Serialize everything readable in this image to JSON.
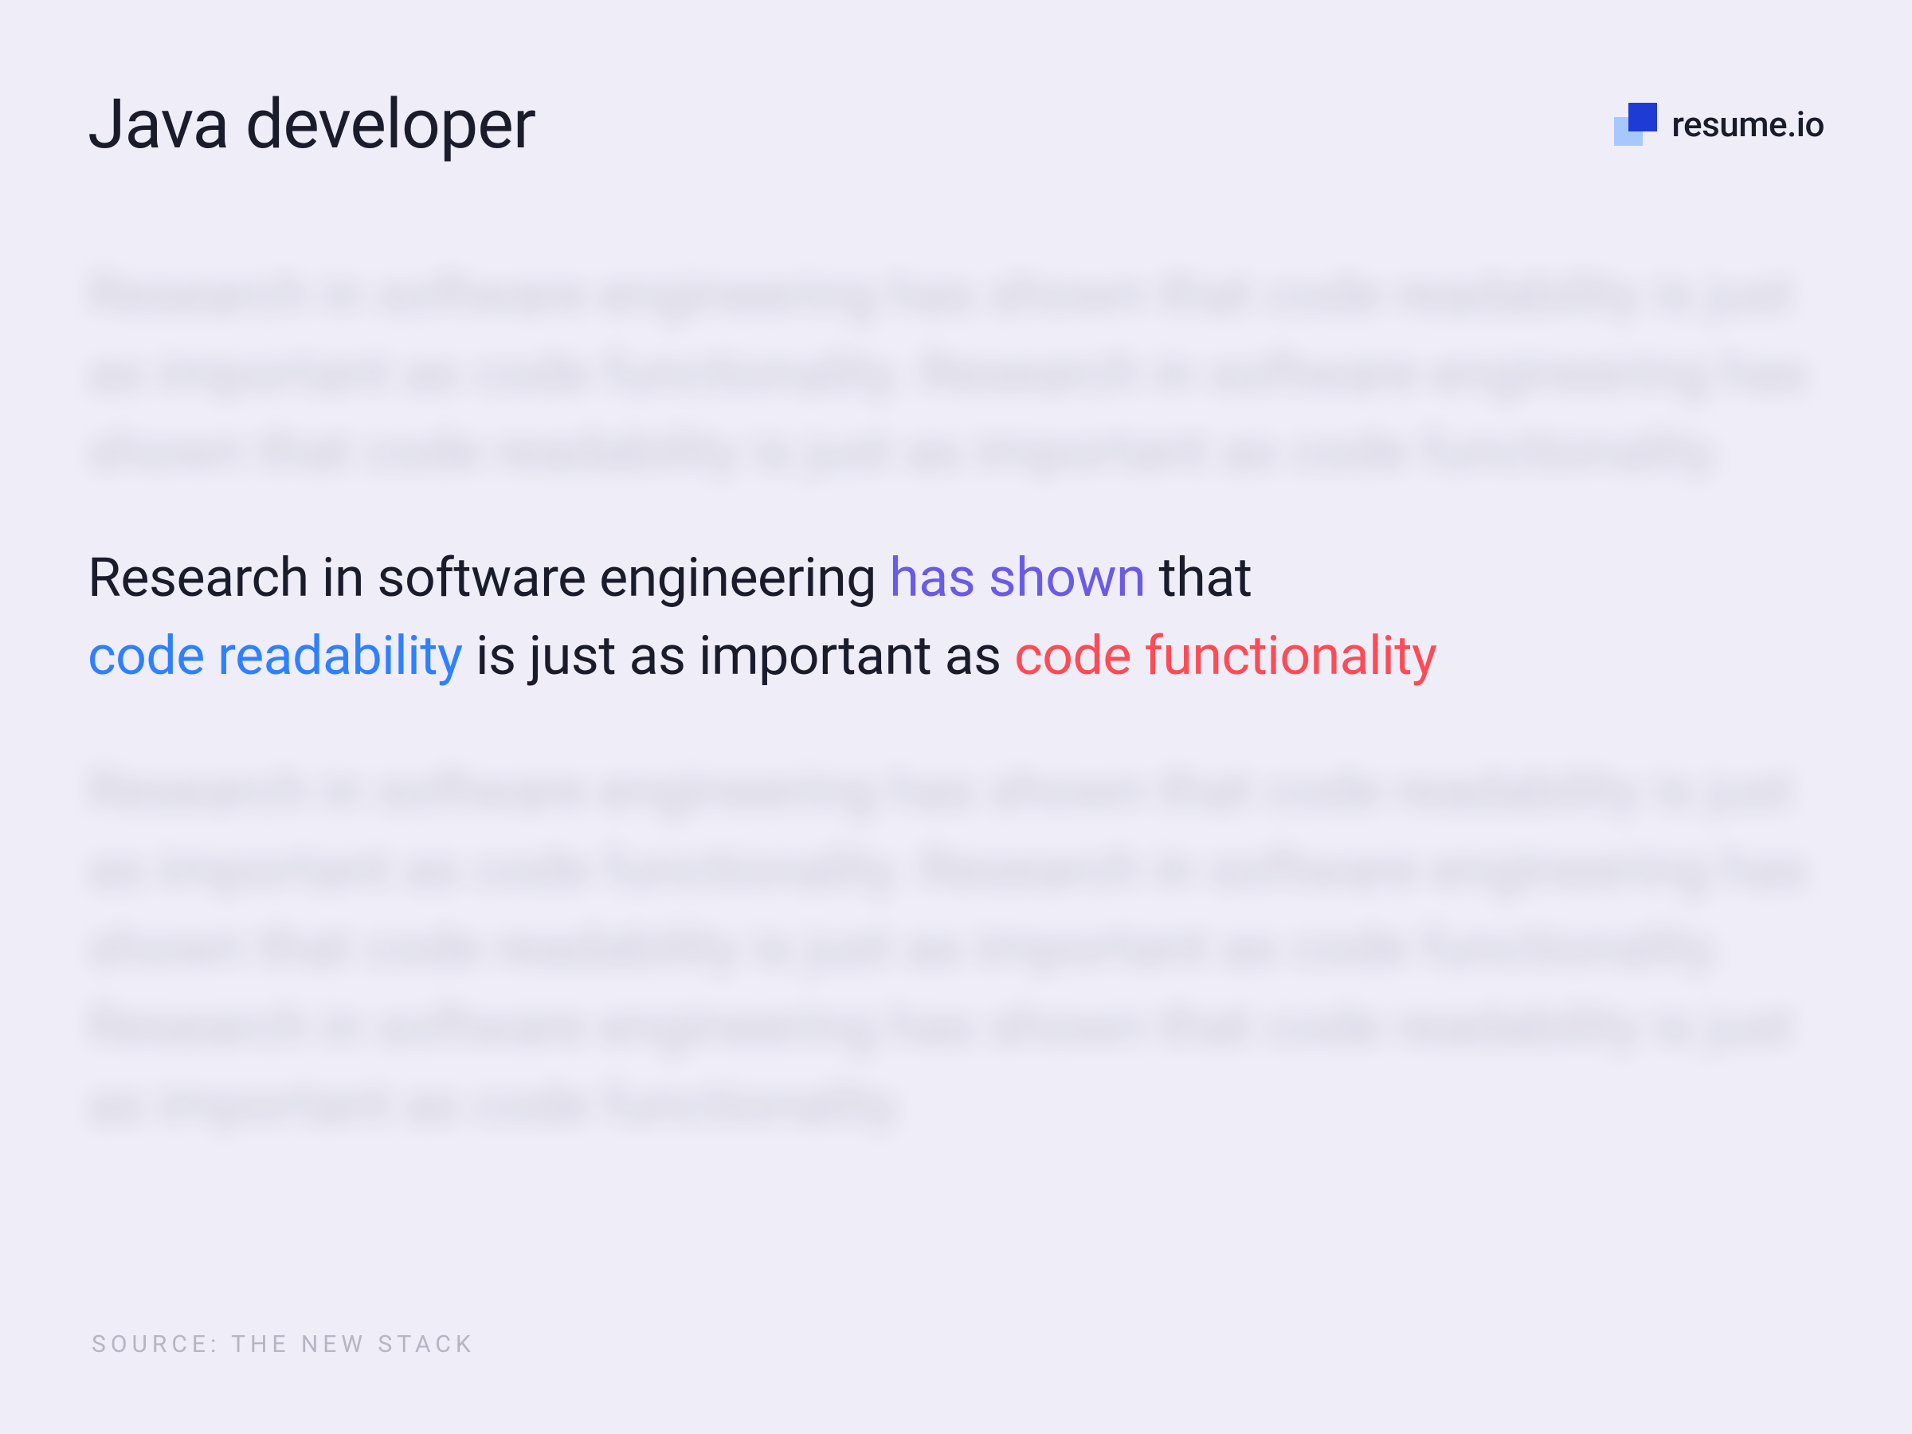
{
  "header": {
    "title": "Java developer",
    "brand_name": "resume.io"
  },
  "blur_text_top": "Research in software engineering has shown that code readability is just as important as code functionality. Research in software engineering has shown that code readability is just as important as code functionality.",
  "blur_text_bottom": "Research in software engineering has shown that code readability is just as important as code functionality. Research in software engineering has shown that code readability is just as important as code functionality. Research in software engineering has shown that code readability is just as important as code functionality.",
  "quote": {
    "seg1": "Research in software engineering ",
    "seg2": "has shown",
    "seg3": " that ",
    "seg4": "code readability",
    "seg5": " is just as important as ",
    "seg6": "code functionality"
  },
  "source_label": "SOURCE: THE NEW STACK",
  "colors": {
    "background": "#eeedf8",
    "text": "#1a1c2c",
    "purple": "#6a5be6",
    "blue": "#2f80ff",
    "red": "#ff4b55",
    "muted": "#b5b5c3",
    "logo_dark": "#1f3bd6",
    "logo_light": "#a7c8ff"
  }
}
